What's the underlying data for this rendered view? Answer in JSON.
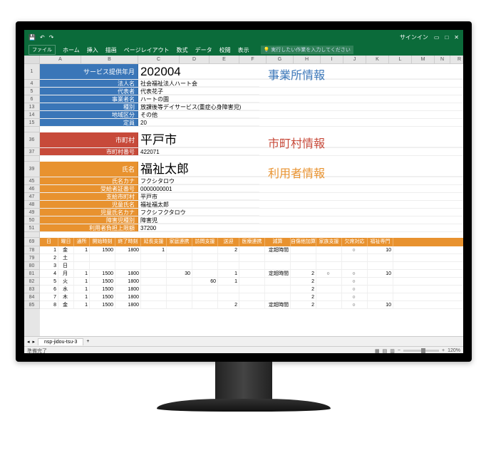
{
  "titlebar": {
    "signin": "サインイン"
  },
  "ribbon": {
    "file": "ファイル",
    "home": "ホーム",
    "insert": "挿入",
    "draw": "描画",
    "pagelayout": "ページレイアウト",
    "formulas": "数式",
    "data": "データ",
    "review": "校閲",
    "view": "表示",
    "search": "実行したい作業を入力してください"
  },
  "columns": [
    "A",
    "B",
    "C",
    "D",
    "E",
    "F",
    "G",
    "H",
    "I",
    "J",
    "K",
    "L",
    "M",
    "N"
  ],
  "lastcol": "R",
  "section1": {
    "title": "事業所情報",
    "rows": [
      {
        "num": "1",
        "label": "サービス提供年月",
        "value": "202004",
        "big": true
      },
      {
        "num": "4",
        "label": "法人名",
        "value": "社会福祉法人ハート会"
      },
      {
        "num": "5",
        "label": "代表者",
        "value": "代表花子"
      },
      {
        "num": "6",
        "label": "事業者名",
        "value": "ハートの園"
      },
      {
        "num": "13",
        "label": "種別",
        "value": "放課後等デイサービス(重症心身障害児)"
      },
      {
        "num": "14",
        "label": "地域区分",
        "value": "その他"
      },
      {
        "num": "15",
        "label": "定員",
        "value": "20"
      }
    ]
  },
  "section2": {
    "title": "市町村情報",
    "rows": [
      {
        "num": "36",
        "label": "市町村",
        "value": "平戸市",
        "big": true
      },
      {
        "num": "37",
        "label": "市町村番号",
        "value": "422071"
      }
    ]
  },
  "section3": {
    "title": "利用者情報",
    "rows": [
      {
        "num": "39",
        "label": "氏名",
        "value": "福祉太郎",
        "big": true
      },
      {
        "num": "45",
        "label": "氏名カナ",
        "value": "フクシタロウ"
      },
      {
        "num": "46",
        "label": "受給者証番号",
        "value": "0000000001"
      },
      {
        "num": "47",
        "label": "支給市町村",
        "value": "平戸市"
      },
      {
        "num": "48",
        "label": "児童氏名",
        "value": "福祉福太郎"
      },
      {
        "num": "49",
        "label": "児童氏名カナ",
        "value": "フクシフクタロウ"
      },
      {
        "num": "50",
        "label": "障害児種別",
        "value": "障害児"
      },
      {
        "num": "51",
        "label": "利用者負担上限額",
        "value": "37200"
      }
    ]
  },
  "table": {
    "rownums": [
      "69",
      "78",
      "79",
      "80",
      "81",
      "82",
      "83",
      "84",
      "85"
    ],
    "headers": [
      "日",
      "曜日",
      "通所",
      "開始時刻",
      "終了時刻",
      "延長支援",
      "家庭連携",
      "訪問支援",
      "送迎",
      "医療連携",
      "減算",
      "自傷他加算",
      "家族支援",
      "欠席対応",
      "福祉専門"
    ],
    "rows": [
      {
        "d": "1",
        "w": "金",
        "t": "1",
        "st": "1500",
        "et": "1800",
        "ext": "1",
        "fam": "",
        "vis": "",
        "sg": "2",
        "med": "",
        "red": "定超時間",
        "j": "",
        "ks": "",
        "ok": "○",
        "fs": "10"
      },
      {
        "d": "2",
        "w": "土",
        "t": "",
        "st": "",
        "et": "",
        "ext": "",
        "fam": "",
        "vis": "",
        "sg": "",
        "med": "",
        "red": "",
        "j": "",
        "ks": "",
        "ok": "",
        "fs": ""
      },
      {
        "d": "3",
        "w": "日",
        "t": "",
        "st": "",
        "et": "",
        "ext": "",
        "fam": "",
        "vis": "",
        "sg": "",
        "med": "",
        "red": "",
        "j": "",
        "ks": "",
        "ok": "",
        "fs": ""
      },
      {
        "d": "4",
        "w": "月",
        "t": "1",
        "st": "1500",
        "et": "1800",
        "ext": "",
        "fam": "30",
        "vis": "",
        "sg": "1",
        "med": "",
        "red": "定超時間",
        "j": "2",
        "ks": "○",
        "ok": "○",
        "fs": "10"
      },
      {
        "d": "5",
        "w": "火",
        "t": "1",
        "st": "1500",
        "et": "1800",
        "ext": "",
        "fam": "",
        "vis": "60",
        "sg": "1",
        "med": "",
        "red": "",
        "j": "2",
        "ks": "",
        "ok": "○",
        "fs": ""
      },
      {
        "d": "6",
        "w": "水",
        "t": "1",
        "st": "1500",
        "et": "1800",
        "ext": "",
        "fam": "",
        "vis": "",
        "sg": "",
        "med": "",
        "red": "",
        "j": "2",
        "ks": "",
        "ok": "○",
        "fs": ""
      },
      {
        "d": "7",
        "w": "木",
        "t": "1",
        "st": "1500",
        "et": "1800",
        "ext": "",
        "fam": "",
        "vis": "",
        "sg": "",
        "med": "",
        "red": "",
        "j": "2",
        "ks": "",
        "ok": "○",
        "fs": ""
      },
      {
        "d": "8",
        "w": "金",
        "t": "1",
        "st": "1500",
        "et": "1800",
        "ext": "",
        "fam": "",
        "vis": "",
        "sg": "2",
        "med": "",
        "red": "定超時間",
        "j": "2",
        "ks": "",
        "ok": "○",
        "fs": "10"
      }
    ]
  },
  "sheet": {
    "name": "nsp-jidou-tsu-3",
    "add": "+"
  },
  "status": {
    "ready": "準備完了",
    "zoom": "120%"
  }
}
